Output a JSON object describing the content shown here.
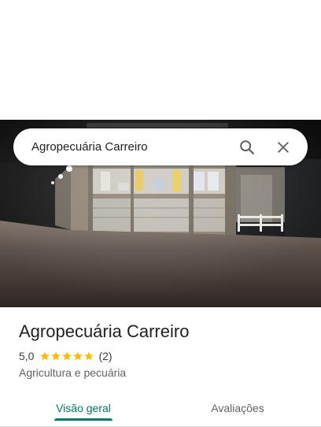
{
  "search": {
    "value": "Agropecuária Carreiro",
    "search_icon": "search-icon",
    "close_icon": "close-icon"
  },
  "hero": {
    "icon": "place-photo"
  },
  "place": {
    "name": "Agropecuária Carreiro",
    "rating": "5,0",
    "stars": 5,
    "review_count": "(2)",
    "category": "Agricultura e pecuária"
  },
  "tabs": [
    {
      "label": "Visão geral",
      "active": true
    },
    {
      "label": "Avaliações",
      "active": false
    }
  ],
  "colors": {
    "accent": "#00796b",
    "star": "#fbbc04"
  }
}
